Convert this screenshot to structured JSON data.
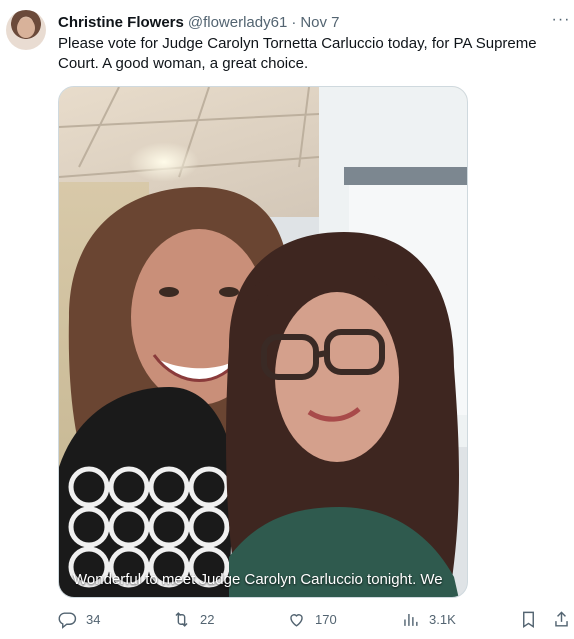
{
  "tweet": {
    "author_name": "Christine Flowers",
    "author_handle": "@flowerlady61",
    "separator": "·",
    "date": "Nov 7",
    "more_label": "···",
    "text": "Please vote for Judge Carolyn Tornetta Carluccio today, for PA Supreme Court. A good woman, a great choice.",
    "media_caption": "Wonderful to meet Judge Carolyn Carluccio tonight. We"
  },
  "actions": {
    "replies": "34",
    "reposts": "22",
    "likes": "170",
    "views": "3.1K"
  },
  "icons": {
    "reply": "reply-icon",
    "repost": "repost-icon",
    "like": "heart-icon",
    "views": "views-icon",
    "bookmark": "bookmark-icon",
    "share": "share-icon",
    "more": "more-icon"
  },
  "colors": {
    "text_primary": "#0f1419",
    "text_secondary": "#536471",
    "border": "#cfd9de"
  }
}
